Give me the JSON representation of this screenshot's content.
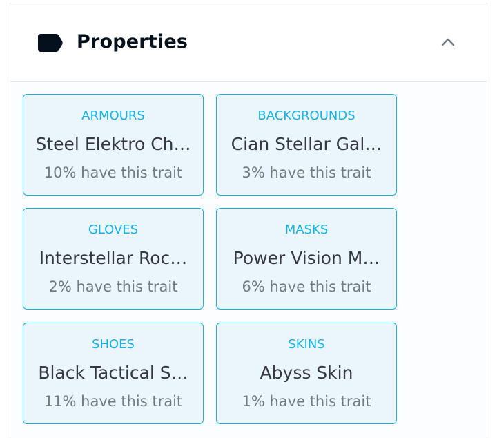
{
  "header": {
    "title": "Properties",
    "tag_icon": "tag-icon",
    "toggle_icon": "chevron-up-icon"
  },
  "properties": [
    {
      "type": "ARMOURS",
      "value": "Steel Elektro Ch…",
      "rarity": "10% have this trait"
    },
    {
      "type": "BACKGROUNDS",
      "value": "Cian Stellar Gal…",
      "rarity": "3% have this trait"
    },
    {
      "type": "GLOVES",
      "value": "Interstellar Roc…",
      "rarity": "2% have this trait"
    },
    {
      "type": "MASKS",
      "value": "Power Vision M…",
      "rarity": "6% have this trait"
    },
    {
      "type": "SHOES",
      "value": "Black Tactical S…",
      "rarity": "11% have this trait"
    },
    {
      "type": "SKINS",
      "value": "Abyss Skin",
      "rarity": "1% have this trait"
    }
  ],
  "colors": {
    "accent": "#15b2e5",
    "card_background": "#ebf6fb",
    "text_primary": "#353840",
    "text_secondary": "#707a83"
  }
}
